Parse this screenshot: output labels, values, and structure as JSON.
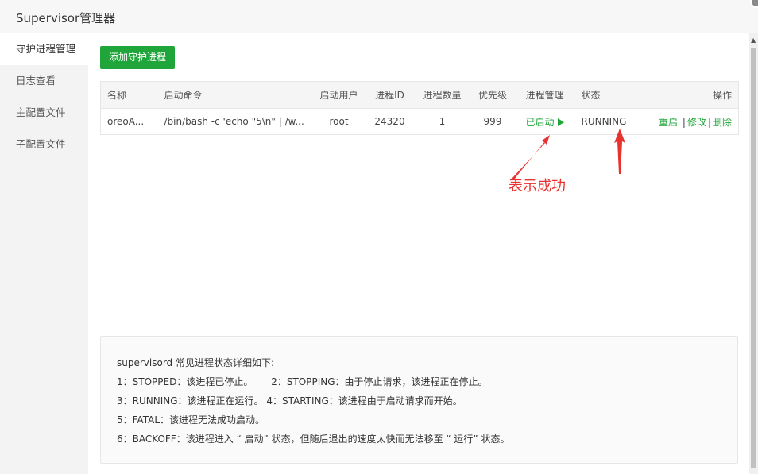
{
  "window": {
    "title": "Supervisor管理器"
  },
  "sidebar": {
    "items": [
      {
        "label": "守护进程管理",
        "active": true
      },
      {
        "label": "日志查看"
      },
      {
        "label": "主配置文件"
      },
      {
        "label": "子配置文件"
      }
    ]
  },
  "toolbar": {
    "add_label": "添加守护进程"
  },
  "table": {
    "headers": {
      "name": "名称",
      "command": "启动命令",
      "user": "启动用户",
      "pid": "进程ID",
      "count": "进程数量",
      "priority": "优先级",
      "manage": "进程管理",
      "status": "状态",
      "action": "操作"
    },
    "rows": [
      {
        "name": "oreoA...",
        "command": "/bin/bash -c 'echo \"5\\n\" | /w...",
        "user": "root",
        "pid": "24320",
        "count": "1",
        "priority": "999",
        "manage": "已启动",
        "status": "RUNNING",
        "restart": "重启",
        "edit": "修改",
        "delete": "删除",
        "separator": "|"
      }
    ]
  },
  "annotation": {
    "text": "表示成功",
    "color": "#e8322f"
  },
  "info": {
    "title": "supervisord 常见进程状态详细如下:",
    "lines": [
      "1：STOPPED：该进程已停止。      2：STOPPING：由于停止请求，该进程正在停止。",
      "3：RUNNING：该进程正在运行。 4：STARTING：该进程由于启动请求而开始。",
      "5：FATAL：该进程无法成功启动。",
      "6：BACKOFF：该进程进入 “ 启动” 状态，但随后退出的速度太快而无法移至 “ 运行” 状态。"
    ]
  },
  "colors": {
    "accent": "#20a53a",
    "annotation": "#e8322f"
  },
  "icons": {
    "manage_running": "play-icon",
    "window_close": "close-icon",
    "scroll_up": "scroll-up-arrow-icon"
  }
}
